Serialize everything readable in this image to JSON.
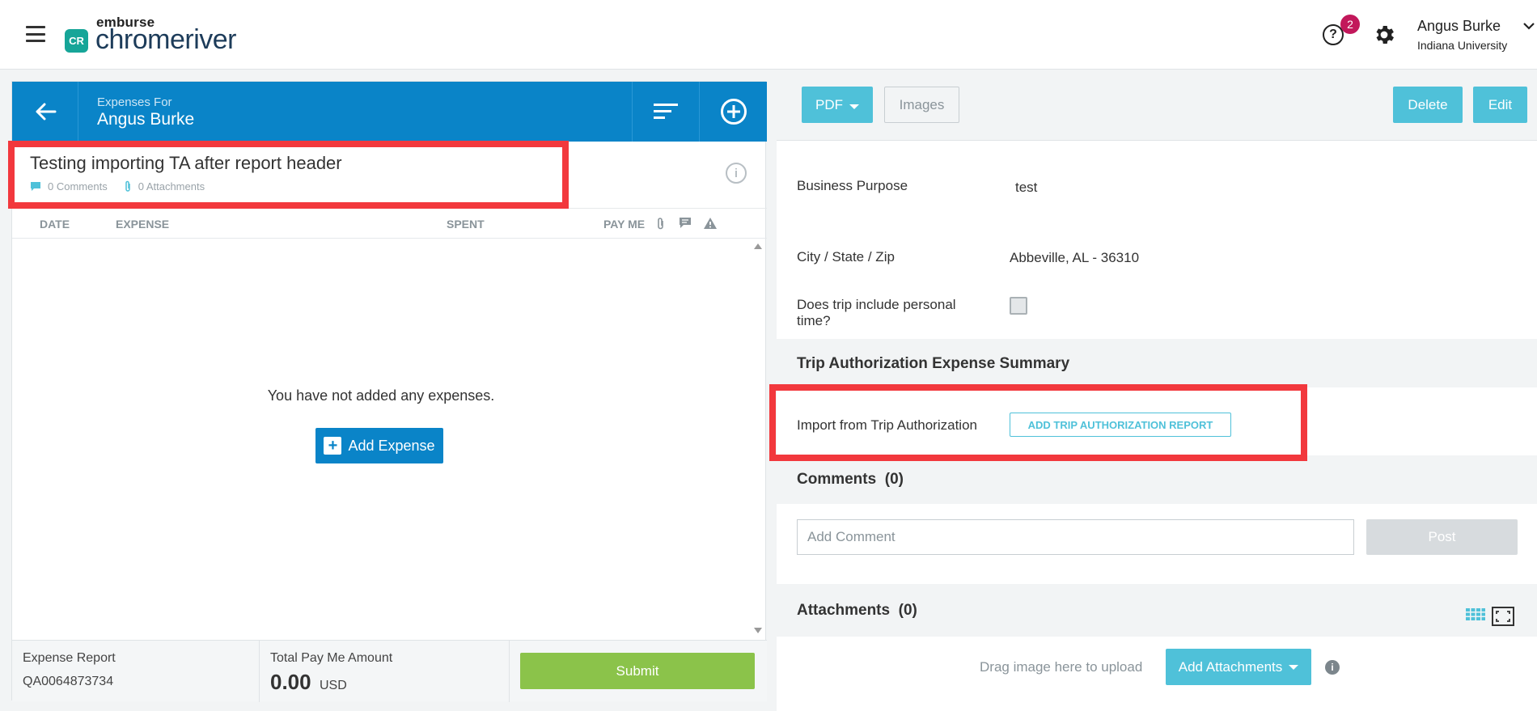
{
  "app": {
    "logo_top": "emburse",
    "logo_main": "chromeriver",
    "logo_mark": "CR",
    "help_badge": "2",
    "user_name": "Angus Burke",
    "user_org": "Indiana University"
  },
  "report_panel": {
    "header_sub": "Expenses For",
    "header_name": "Angus Burke",
    "report_title": "Testing importing TA after report header",
    "comments_meta": "0 Comments",
    "attachments_meta": "0 Attachments",
    "columns": [
      "DATE",
      "EXPENSE",
      "SPENT",
      "PAY ME"
    ],
    "empty_message": "You have not added any expenses.",
    "add_expense_label": "Add Expense",
    "footer": {
      "report_label": "Expense Report",
      "report_id": "QA0064873734",
      "total_label": "Total Pay Me Amount",
      "total_amount": "0.00",
      "currency": "USD",
      "submit_label": "Submit"
    }
  },
  "detail_panel": {
    "toolbar": {
      "pdf_label": "PDF",
      "images_label": "Images",
      "delete_label": "Delete",
      "edit_label": "Edit"
    },
    "fields": [
      {
        "label": "Business Purpose",
        "value": "test"
      },
      {
        "label": "City / State / Zip",
        "value": "Abbeville, AL - 36310"
      },
      {
        "label": "Does trip include personal time?",
        "value": ""
      }
    ],
    "ta_section_title": "Trip Authorization Expense Summary",
    "ta_import_label": "Import from Trip Authorization",
    "ta_button_label": "ADD TRIP AUTHORIZATION REPORT",
    "comments_title": "Comments",
    "comments_count": "(0)",
    "comment_placeholder": "Add Comment",
    "post_label": "Post",
    "attachments_title": "Attachments",
    "attachments_count": "(0)",
    "drag_text": "Drag image here to upload",
    "add_attachments_label": "Add Attachments"
  },
  "colors": {
    "primary_blue": "#0a84c8",
    "accent_teal": "#4fc1d9",
    "submit_green": "#8bc34a",
    "badge": "#c2185b",
    "highlight": "#f2383d"
  }
}
